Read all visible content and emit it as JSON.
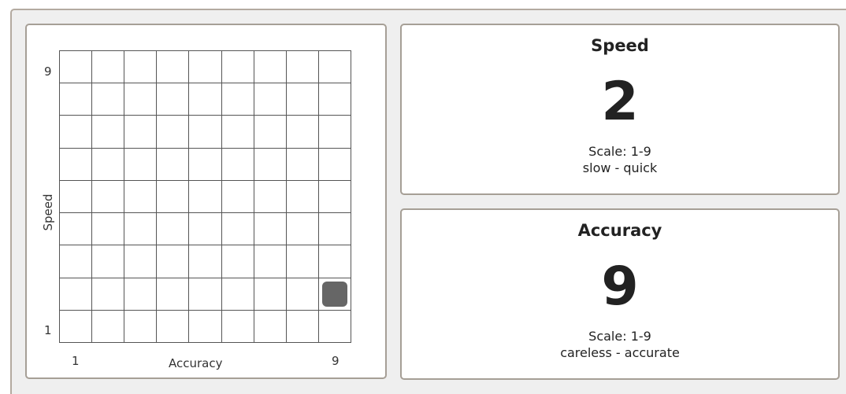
{
  "grid": {
    "x_axis_label": "Accuracy",
    "y_axis_label": "Speed",
    "x_min_label": "1",
    "x_max_label": "9",
    "y_min_label": "1",
    "y_max_label": "9",
    "size": 9,
    "selected": {
      "accuracy": 9,
      "speed": 2
    },
    "marker_color": "#666666"
  },
  "speed": {
    "title": "Speed",
    "value": "2",
    "scale": "Scale: 1-9",
    "range": "slow - quick"
  },
  "accuracy": {
    "title": "Accuracy",
    "value": "9",
    "scale": "Scale: 1-9",
    "range": "careless - accurate"
  }
}
